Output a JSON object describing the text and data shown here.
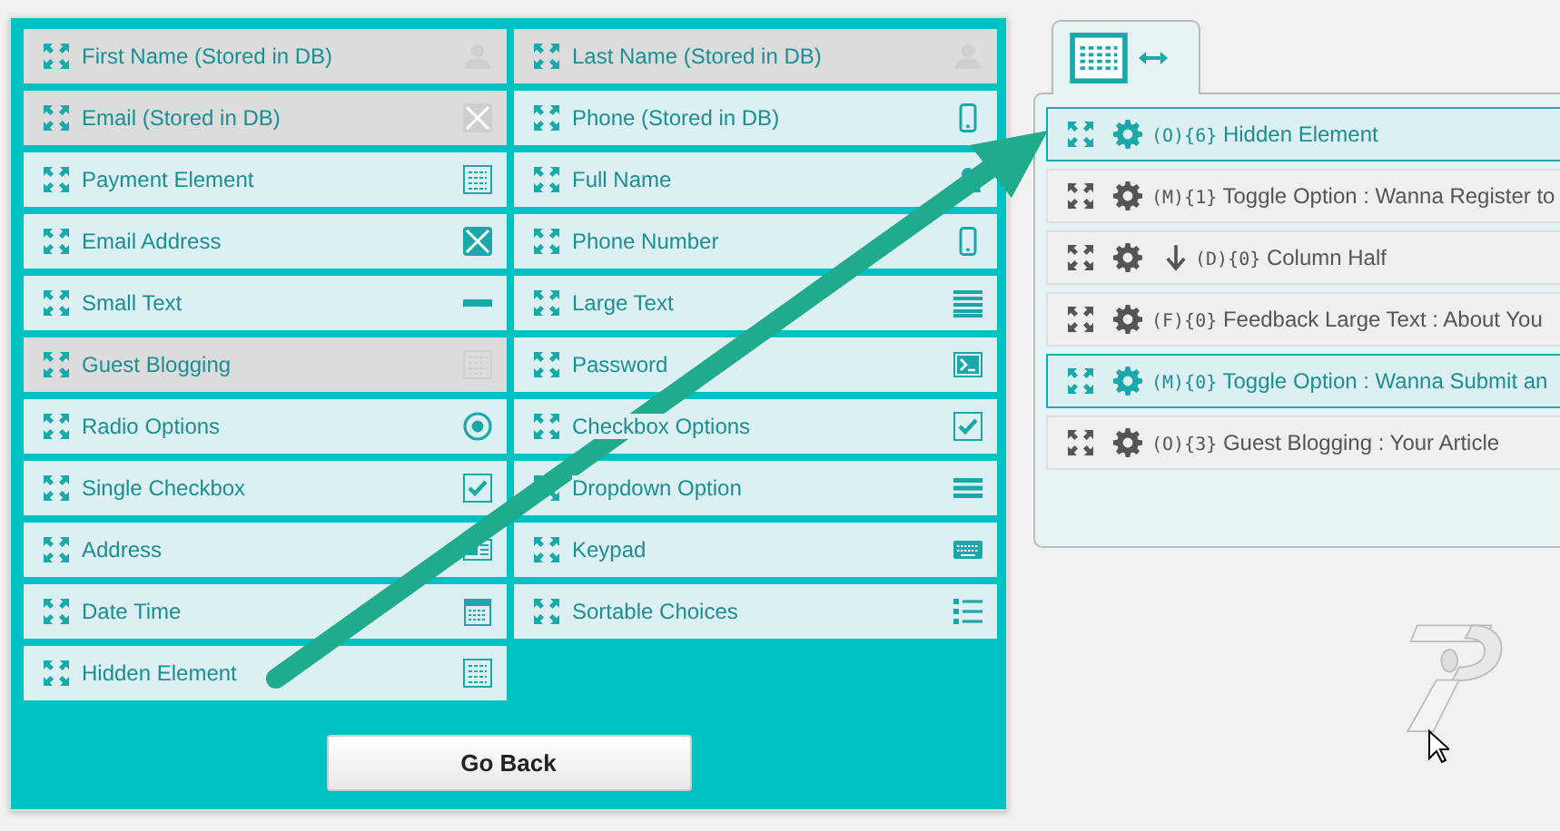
{
  "fields": [
    {
      "label": "First Name (Stored in DB)",
      "disabled": true,
      "kind": "person"
    },
    {
      "label": "Last Name (Stored in DB)",
      "disabled": true,
      "kind": "person"
    },
    {
      "label": "Email (Stored in DB)",
      "disabled": true,
      "kind": "envelope"
    },
    {
      "label": "Phone (Stored in DB)",
      "disabled": false,
      "kind": "phone"
    },
    {
      "label": "Payment Element",
      "disabled": false,
      "kind": "grid"
    },
    {
      "label": "Full Name",
      "disabled": false,
      "kind": "person"
    },
    {
      "label": "Email Address",
      "disabled": false,
      "kind": "envelope"
    },
    {
      "label": "Phone Number",
      "disabled": false,
      "kind": "phone"
    },
    {
      "label": "Small Text",
      "disabled": false,
      "kind": "dash"
    },
    {
      "label": "Large Text",
      "disabled": false,
      "kind": "lines"
    },
    {
      "label": "Guest Blogging",
      "disabled": true,
      "kind": "grid"
    },
    {
      "label": "Password",
      "disabled": false,
      "kind": "terminal"
    },
    {
      "label": "Radio Options",
      "disabled": false,
      "kind": "radio"
    },
    {
      "label": "Checkbox Options",
      "disabled": false,
      "kind": "check"
    },
    {
      "label": "Single Checkbox",
      "disabled": false,
      "kind": "check"
    },
    {
      "label": "Dropdown Option",
      "disabled": false,
      "kind": "menu"
    },
    {
      "label": "Address",
      "disabled": false,
      "kind": "card"
    },
    {
      "label": "Keypad",
      "disabled": false,
      "kind": "keyboard"
    },
    {
      "label": "Date Time",
      "disabled": false,
      "kind": "calendar"
    },
    {
      "label": "Sortable Choices",
      "disabled": false,
      "kind": "list"
    },
    {
      "label": "Hidden Element",
      "disabled": false,
      "kind": "grid"
    }
  ],
  "back_button": "Go Back",
  "form_items": [
    {
      "code": "(O){6}",
      "label": "Hidden Element",
      "selected": true,
      "kind": "field"
    },
    {
      "code": "(M){1}",
      "label": "Toggle Option : Wanna Register to",
      "selected": false,
      "kind": "field"
    },
    {
      "code": "(D){0}",
      "label": "Column Half",
      "selected": false,
      "kind": "column"
    },
    {
      "code": "(F){0}",
      "label": "Feedback Large Text : About You",
      "selected": false,
      "kind": "field"
    },
    {
      "code": "(M){0}",
      "label": "Toggle Option : Wanna Submit an",
      "selected": true,
      "kind": "field"
    },
    {
      "code": "(O){3}",
      "label": "Guest Blogging : Your Article",
      "selected": false,
      "kind": "field"
    }
  ]
}
